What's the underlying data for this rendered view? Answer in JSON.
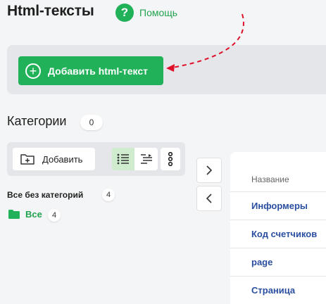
{
  "header": {
    "title": "Html-тексты",
    "help_icon": "?",
    "help_label": "Помощь"
  },
  "toolbar_main": {
    "add_button_label": "Добавить html-текст"
  },
  "categories": {
    "title": "Категории",
    "count": "0",
    "add_label": "Добавить",
    "all_without_category_label": "Все без категорий",
    "all_without_category_count": "4",
    "all_label": "Все",
    "all_count": "4"
  },
  "table": {
    "column_header": "Название",
    "rows": [
      "Информеры",
      "Код счетчиков",
      "page",
      "Страница"
    ]
  },
  "colors": {
    "accent": "#21b259",
    "link": "#2a4fa0",
    "arrow": "#e0102a"
  }
}
